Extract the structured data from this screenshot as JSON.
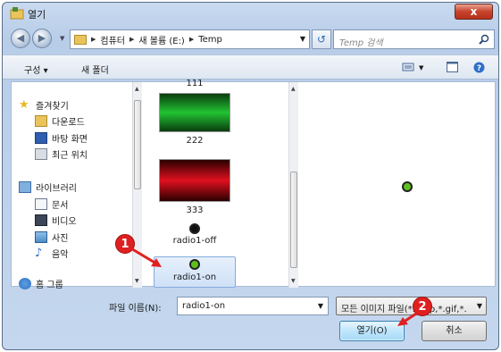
{
  "window": {
    "title": "열기",
    "close_label": "x"
  },
  "address": {
    "breadcrumbs": [
      "컴퓨터",
      "새 볼륨 (E:)",
      "Temp"
    ],
    "search_placeholder": "Temp 검색"
  },
  "toolbar": {
    "organize_label": "구성 ▾",
    "new_folder_label": "새 폴더"
  },
  "sidebar": {
    "favorites_label": "즐겨찾기",
    "favorites": [
      {
        "label": "다운로드",
        "icon": "download-folder-icon"
      },
      {
        "label": "바탕 화면",
        "icon": "desktop-icon"
      },
      {
        "label": "최근 위치",
        "icon": "recent-places-icon"
      }
    ],
    "libraries_label": "라이브러리",
    "libraries": [
      {
        "label": "문서",
        "icon": "documents-icon"
      },
      {
        "label": "비디오",
        "icon": "video-icon"
      },
      {
        "label": "사진",
        "icon": "pictures-icon"
      },
      {
        "label": "음악",
        "icon": "music-icon"
      }
    ],
    "homegroup_label": "홈 그룹"
  },
  "files": [
    {
      "name": "111",
      "color_top": "#0a3d10",
      "color_mid": "#22c232",
      "color_bottom": "#0a3d10"
    },
    {
      "name": "222",
      "color_top": "#0a3d10",
      "color_mid": "#22c232",
      "color_bottom": "#0a3d10"
    },
    {
      "name": "333",
      "color_top": "#2a0000",
      "color_mid": "#e01020",
      "color_bottom": "#2a0000"
    },
    {
      "name": "radio1-off"
    },
    {
      "name": "radio1-on",
      "selected": true
    }
  ],
  "bottom": {
    "filename_label": "파일 이름(N):",
    "filename_value": "radio1-on",
    "filetype_value": "모든 이미지 파일(*.bmp,*.gif,*.",
    "open_label": "열기(O)",
    "cancel_label": "취소"
  },
  "callouts": {
    "step1": "1",
    "step2": "2"
  },
  "colors": {
    "accent": "#3c7fb1",
    "callout": "#e02020",
    "radio_fill": "#5fbf1f"
  }
}
